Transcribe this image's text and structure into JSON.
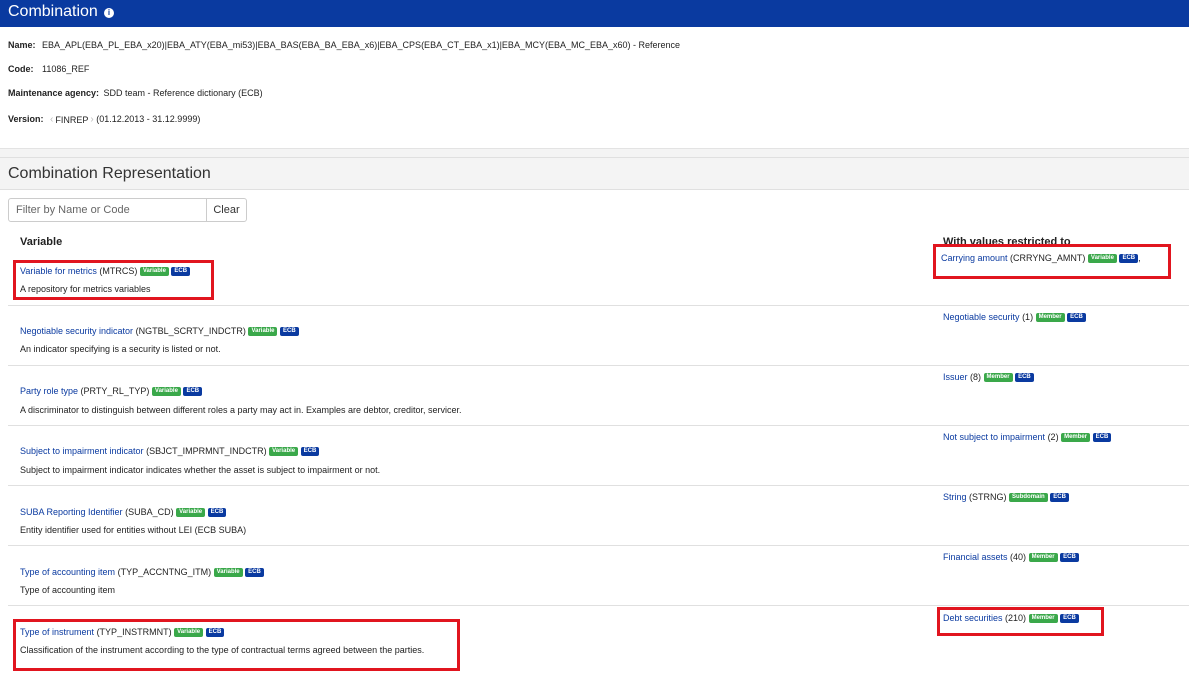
{
  "header": {
    "title": "Combination",
    "info_icon": "info-icon"
  },
  "meta": {
    "name_label": "Name:",
    "name_value": "EBA_APL(EBA_PL_EBA_x20)|EBA_ATY(EBA_mi53)|EBA_BAS(EBA_BA_EBA_x6)|EBA_CPS(EBA_CT_EBA_x1)|EBA_MCY(EBA_MC_EBA_x60) - Reference",
    "code_label": "Code:",
    "code_value": "11086_REF",
    "agency_label": "Maintenance agency:",
    "agency_value": "SDD team - Reference dictionary (ECB)",
    "version_label": "Version:",
    "version_name": "FINREP",
    "version_range": "(01.12.2013 - 31.12.9999)"
  },
  "section": {
    "title": "Combination Representation"
  },
  "filter": {
    "placeholder": "Filter by Name or Code",
    "clear_label": "Clear"
  },
  "columns": {
    "variable": "Variable",
    "values": "With values restricted to"
  },
  "rows": [
    {
      "var_name": "Variable for metrics",
      "var_code": "(MTRCS)",
      "var_badge": "Variable",
      "var_owner": "ECB",
      "desc": "A repository for metrics variables",
      "val_name": "Carrying amount",
      "val_code": "(CRRYNG_AMNT)",
      "val_badge": "Variable",
      "val_owner": "ECB",
      "val_suffix": ","
    },
    {
      "var_name": "Negotiable security indicator",
      "var_code": "(NGTBL_SCRTY_INDCTR)",
      "var_badge": "Variable",
      "var_owner": "ECB",
      "desc": "An indicator specifying is a security is listed or not.",
      "val_name": "Negotiable security",
      "val_code": "(1)",
      "val_badge": "Member",
      "val_owner": "ECB",
      "val_suffix": ""
    },
    {
      "var_name": "Party role type",
      "var_code": "(PRTY_RL_TYP)",
      "var_badge": "Variable",
      "var_owner": "ECB",
      "desc": "A discriminator to distinguish between different roles a party may act in. Examples are debtor, creditor, servicer.",
      "val_name": "Issuer",
      "val_code": "(8)",
      "val_badge": "Member",
      "val_owner": "ECB",
      "val_suffix": ""
    },
    {
      "var_name": "Subject to impairment indicator",
      "var_code": "(SBJCT_IMPRMNT_INDCTR)",
      "var_badge": "Variable",
      "var_owner": "ECB",
      "desc": "Subject to impairment indicator indicates whether the asset is subject to impairment or not.",
      "val_name": "Not subject to impairment",
      "val_code": "(2)",
      "val_badge": "Member",
      "val_owner": "ECB",
      "val_suffix": ""
    },
    {
      "var_name": "SUBA Reporting Identifier",
      "var_code": "(SUBA_CD)",
      "var_badge": "Variable",
      "var_owner": "ECB",
      "desc": "Entity identifier used for entities without LEI (ECB SUBA)",
      "val_name": "String",
      "val_code": "(STRNG)",
      "val_badge": "Subdomain",
      "val_owner": "ECB",
      "val_suffix": ""
    },
    {
      "var_name": "Type of accounting item",
      "var_code": "(TYP_ACCNTNG_ITM)",
      "var_badge": "Variable",
      "var_owner": "ECB",
      "desc": "Type of accounting item",
      "val_name": "Financial assets",
      "val_code": "(40)",
      "val_badge": "Member",
      "val_owner": "ECB",
      "val_suffix": ""
    },
    {
      "var_name": "Type of instrument",
      "var_code": "(TYP_INSTRMNT)",
      "var_badge": "Variable",
      "var_owner": "ECB",
      "desc": "Classification of the instrument according to the type of contractual terms agreed between the parties.",
      "val_name": "Debt securities",
      "val_code": "(210)",
      "val_badge": "Member",
      "val_owner": "ECB",
      "val_suffix": ""
    }
  ],
  "colors": {
    "brand": "#0a3aa0",
    "badge_green": "#3aa84a",
    "highlight": "#e1151f"
  }
}
